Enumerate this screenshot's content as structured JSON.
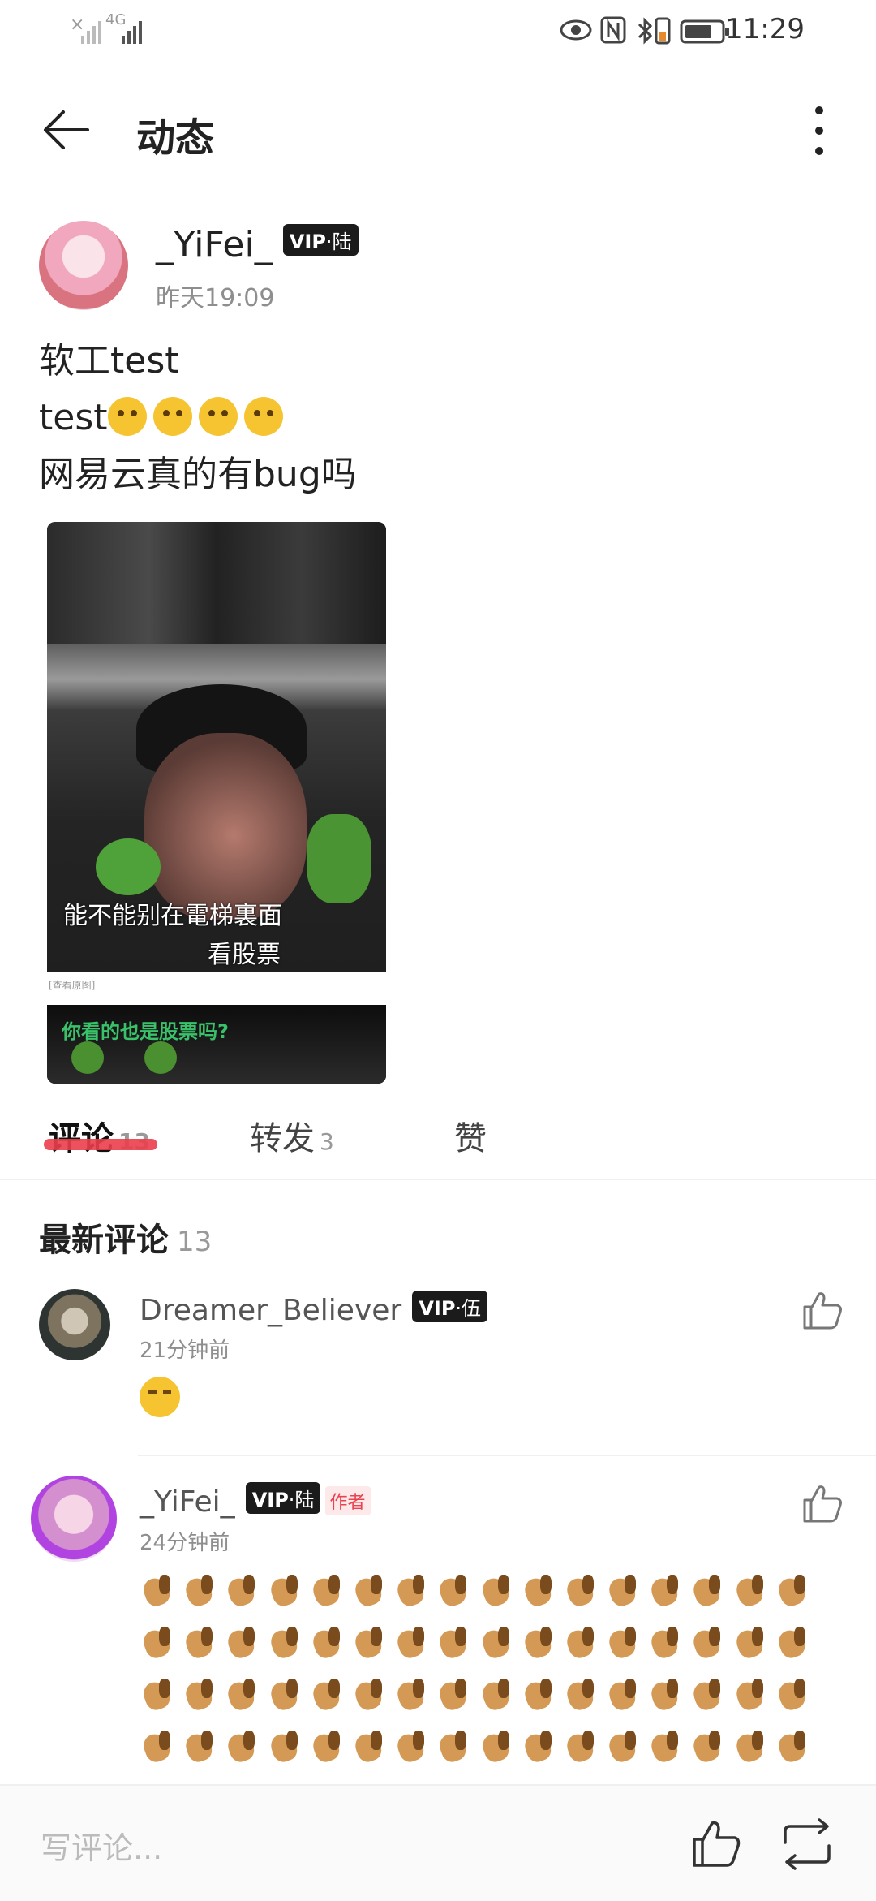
{
  "status_bar": {
    "network_left": "×",
    "network_type": "4G",
    "time": "11:29",
    "icons": [
      "eye-icon",
      "nfc-icon",
      "bluetooth-icon",
      "vibrate-icon",
      "battery-icon"
    ]
  },
  "header": {
    "title": "动态",
    "back_icon": "arrow-left-icon",
    "more_icon": "more-vertical-icon"
  },
  "post": {
    "author": "_YiFei_",
    "vip_badge": "VIP",
    "vip_level": "·陆",
    "time": "昨天19:09",
    "lines": [
      "软工test",
      "test",
      "网易云真的有bug吗"
    ],
    "emoji_count": 4,
    "image": {
      "caption_1": "能不能别在電梯裏面",
      "caption_2": "看股票",
      "strip_label": "[查看原图]",
      "caption_3": "你看的也是股票吗?"
    }
  },
  "tabs": [
    {
      "label": "评论",
      "count": "13",
      "active": true
    },
    {
      "label": "转发",
      "count": "3",
      "active": false
    },
    {
      "label": "赞",
      "count": "",
      "active": false
    }
  ],
  "section": {
    "title": "最新评论",
    "count": "13"
  },
  "comments": [
    {
      "name": "Dreamer_Believer",
      "vip_badge": "VIP",
      "vip_level": "·伍",
      "time": "21分钟前",
      "content_emoji": "unamused-face-emoji"
    },
    {
      "name": "_YiFei_",
      "vip_badge": "VIP",
      "vip_level": "·陆",
      "author_tag": "作者",
      "time": "24分钟前",
      "content_emoji": "horse-face-emoji",
      "emoji_rows": 4,
      "emoji_per_row": 16
    }
  ],
  "bottom_bar": {
    "placeholder": "写评论...",
    "like_icon": "thumbs-up-icon",
    "share_icon": "repost-icon"
  },
  "colors": {
    "accent": "#ea3e4b",
    "vip_bg": "#1b1b1b",
    "text_gray": "#8e8e8e"
  }
}
